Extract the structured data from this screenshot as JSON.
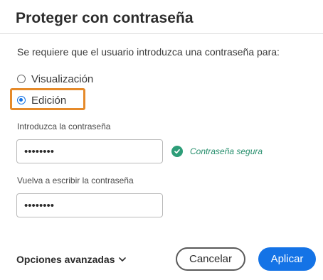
{
  "dialog": {
    "title": "Proteger con contraseña",
    "prompt": "Se requiere que el usuario introduzca una contraseña para:",
    "options": [
      {
        "label": "Visualización",
        "selected": false
      },
      {
        "label": "Edición",
        "selected": true
      }
    ],
    "password": {
      "label": "Introduzca la contraseña",
      "value": "••••••••",
      "strength_text": "Contraseña segura"
    },
    "confirm": {
      "label": "Vuelva a escribir la contraseña",
      "value": "••••••••"
    },
    "advanced_label": "Opciones avanzadas",
    "cancel_label": "Cancelar",
    "apply_label": "Aplicar"
  },
  "colors": {
    "accent": "#1473e6",
    "highlight": "#e58a2a",
    "success": "#2d9d78"
  },
  "icons": {
    "strength": "check-circle-icon",
    "advanced": "chevron-down-icon"
  }
}
